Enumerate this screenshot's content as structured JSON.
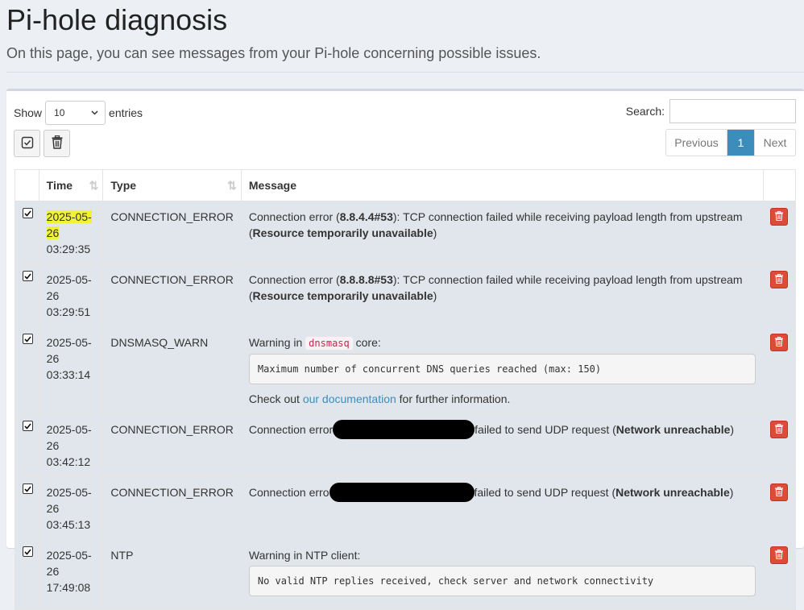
{
  "page": {
    "title": "Pi-hole diagnosis",
    "subtitle": "On this page, you can see messages from your Pi-hole concerning possible issues."
  },
  "controls": {
    "show_label": "Show",
    "entries_value": "10",
    "entries_label": "entries",
    "search_label": "Search:",
    "search_value": "",
    "pagination": {
      "previous": "Previous",
      "current": "1",
      "next": "Next"
    }
  },
  "table": {
    "headers": {
      "time": "Time",
      "type": "Type",
      "message": "Message"
    },
    "rows": [
      {
        "date": "2025-05-26",
        "time": "03:29:35",
        "type": "CONNECTION_ERROR",
        "msg_a": "Connection error (",
        "msg_b": "8.8.4.4#53",
        "msg_c": "): TCP connection failed while receiving payload length from upstream (",
        "msg_d": "Resource temporarily unavailable",
        "msg_e": ")"
      },
      {
        "date": "2025-05-26",
        "time": "03:29:51",
        "type": "CONNECTION_ERROR",
        "msg_a": "Connection error (",
        "msg_b": "8.8.8.8#53",
        "msg_c": "): TCP connection failed while receiving payload length from upstream (",
        "msg_d": "Resource temporarily unavailable",
        "msg_e": ")"
      },
      {
        "date": "2025-05-26",
        "time": "03:33:14",
        "type": "DNSMASQ_WARN",
        "msg_a": "Warning in ",
        "msg_code": "dnsmasq",
        "msg_b": " core:",
        "pre": "Maximum number of concurrent DNS queries reached (max: 150)",
        "msg_c": "Check out ",
        "link": "our documentation",
        "msg_d": " for further information."
      },
      {
        "date": "2025-05-26",
        "time": "03:42:12",
        "type": "CONNECTION_ERROR",
        "msg_a": "Connection error",
        "msg_b": "failed to send UDP request (",
        "msg_c": "Network unreachable",
        "msg_d": ")"
      },
      {
        "date": "2025-05-26",
        "time": "03:45:13",
        "type": "CONNECTION_ERROR",
        "msg_a": "Connection erro",
        "msg_b": "failed to send UDP request (",
        "msg_c": "Network unreachable",
        "msg_d": ")"
      },
      {
        "date": "2025-05-26",
        "time": "17:49:08",
        "type": "NTP",
        "msg_a": "Warning in NTP client:",
        "pre": "No valid NTP replies received, check server and network connectivity"
      }
    ]
  },
  "colors": {
    "highlight": "#f1f13a",
    "primary": "#3c8dbc",
    "danger": "#dd4b39",
    "row_bg": "#e1e6ec"
  },
  "icons": {
    "checkbox": "checked-square-icon",
    "delete": "trash-icon",
    "sort": "sort-arrows-icon"
  }
}
